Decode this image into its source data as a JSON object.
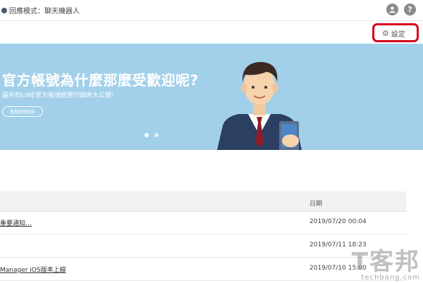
{
  "topbar": {
    "mode_label": "回應模式：聊天機器人",
    "account_icon": "user-icon",
    "help_icon": "help-icon",
    "help_glyph": "?"
  },
  "settings": {
    "label": "設定",
    "icon": "gear-icon",
    "highlight_color": "#d6001c"
  },
  "banner": {
    "title": "官方帳號為什麼那麼受歡迎呢?",
    "subtitle": "最夯的LINE官方帳號經營行銷術大公開!",
    "button_label": "查看經營祕訣",
    "background": "#a2d0ea",
    "slides_total": 2,
    "active_slide": 1
  },
  "table": {
    "columns": [
      "",
      "日期"
    ],
    "rows": [
      {
        "title": "重要通知…",
        "date": "2019/07/20 00:04"
      },
      {
        "title": "",
        "date": "2019/07/11 18:23"
      },
      {
        "title": "Manager iOS版本上線",
        "date": "2019/07/10 15:00"
      }
    ]
  },
  "watermark": {
    "big": "T客邦",
    "small": "techbang.com"
  }
}
